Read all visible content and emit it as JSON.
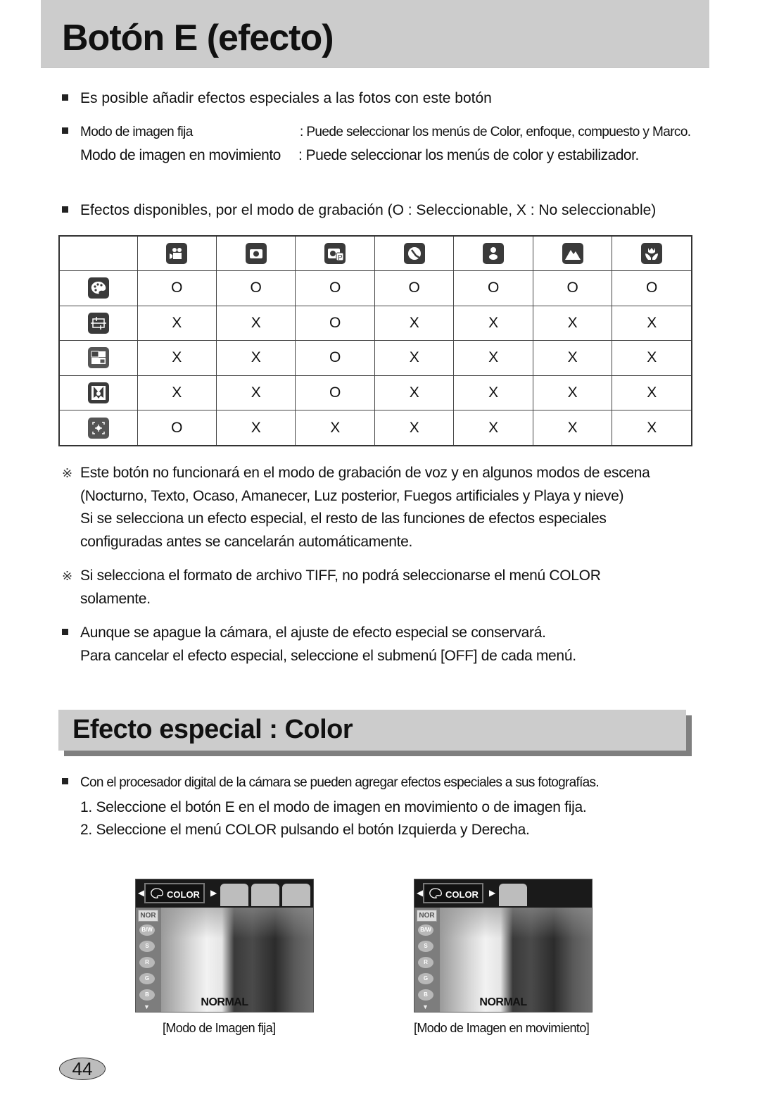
{
  "page": {
    "title": "Botón E (efecto)",
    "intro": "Es posible añadir efectos especiales a las fotos con este botón",
    "modes": [
      {
        "label": "Modo de imagen fija",
        "desc": ": Puede seleccionar los menús de Color, enfoque, compuesto y Marco."
      },
      {
        "label": "Modo de imagen en movimiento",
        "desc": ": Puede seleccionar los menús de color y estabilizador."
      }
    ],
    "table_intro": "Efectos disponibles, por el modo de grabación (O : Seleccionable, X : No seleccionable)",
    "table": {
      "column_icons": [
        "movie-mode-icon",
        "auto-mode-icon",
        "program-mode-icon",
        "night-scene-icon",
        "portrait-icon",
        "landscape-icon",
        "macro-icon"
      ],
      "rows": [
        {
          "icon": "color-palette-icon",
          "values": [
            "O",
            "O",
            "O",
            "O",
            "O",
            "O",
            "O"
          ]
        },
        {
          "icon": "focus-frame-icon",
          "values": [
            "X",
            "X",
            "O",
            "X",
            "X",
            "X",
            "X"
          ]
        },
        {
          "icon": "composite-icon",
          "values": [
            "X",
            "X",
            "O",
            "X",
            "X",
            "X",
            "X"
          ]
        },
        {
          "icon": "photo-frame-icon",
          "values": [
            "X",
            "X",
            "O",
            "X",
            "X",
            "X",
            "X"
          ]
        },
        {
          "icon": "stabilizer-icon",
          "values": [
            "O",
            "X",
            "X",
            "X",
            "X",
            "X",
            "X"
          ]
        }
      ]
    },
    "notes": [
      {
        "mark": "※",
        "lines": [
          "Este botón no funcionará en el modo de grabación de voz y en algunos modos de escena",
          "(Nocturno, Texto, Ocaso, Amanecer, Luz posterior, Fuegos artificiales y Playa y nieve)",
          "Si se selecciona un efecto especial, el resto de las funciones de efectos especiales",
          "configuradas antes se cancelarán automáticamente."
        ]
      },
      {
        "mark": "※",
        "lines": [
          "Si selecciona el formato de archivo TIFF, no podrá seleccionarse el menú COLOR",
          "solamente."
        ]
      }
    ],
    "keep_note": [
      "Aunque se apague la cámara, el ajuste de efecto especial se conservará.",
      "Para cancelar el efecto especial, seleccione el submenú [OFF] de cada menú."
    ],
    "section_title": "Efecto especial : Color",
    "section_intro": "Con el procesador digital de la cámara se pueden agregar efectos especiales a sus fotografías.",
    "steps": [
      "1. Seleccione el botón E en el modo de imagen en movimiento o de imagen fija.",
      "2. Seleccione el menú COLOR  pulsando el botón Izquierda y Derecha."
    ],
    "screens": [
      {
        "tab_label": "COLOR",
        "side_items": [
          "NOR",
          "B/W",
          "S",
          "R",
          "G",
          "B"
        ],
        "status": "NORMAL",
        "caption": "[Modo de Imagen fija]",
        "extra_tabs": [
          "focus-frame-icon",
          "composite-icon",
          "photo-frame-icon"
        ]
      },
      {
        "tab_label": "COLOR",
        "side_items": [
          "NOR",
          "B/W",
          "S",
          "R",
          "G",
          "B"
        ],
        "status": "NORMAL",
        "caption": "[Modo de Imagen en movimiento]",
        "extra_tabs": [
          "stabilizer-icon"
        ]
      }
    ],
    "page_number": "44"
  }
}
